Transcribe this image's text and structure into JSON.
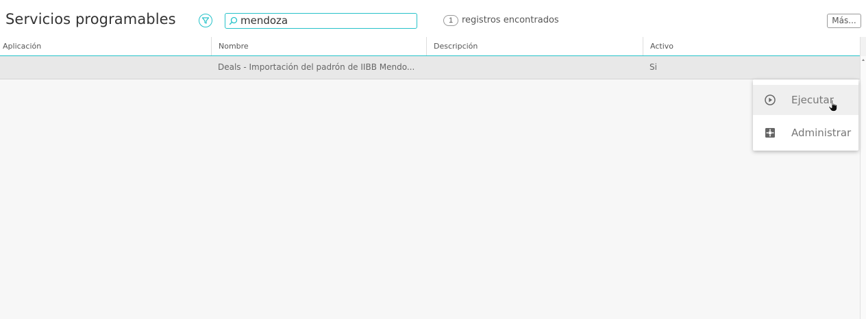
{
  "page": {
    "title": "Servicios programables"
  },
  "toolbar": {
    "filter_icon": "filter-icon",
    "search_icon": "search-icon",
    "search_value": "mendoza",
    "record_count": "1",
    "record_count_label": "registros encontrados",
    "more_label": "Más..."
  },
  "grid": {
    "columns": [
      "Aplicación",
      "Nombre",
      "Descripción",
      "Activo"
    ],
    "rows": [
      {
        "aplicacion": "",
        "nombre": "Deals - Importación del padrón de IIBB Mendo...",
        "descripcion": "",
        "activo": "Si"
      }
    ]
  },
  "context_menu": {
    "items": [
      {
        "label": "Ejecutar",
        "icon": "play-circle-icon",
        "hovered": true
      },
      {
        "label": "Administrar",
        "icon": "gear-icon",
        "hovered": false
      }
    ]
  },
  "colors": {
    "accent": "#25c2c9",
    "row_selected": "#e8e8e8",
    "background": "#f7f7f7"
  }
}
